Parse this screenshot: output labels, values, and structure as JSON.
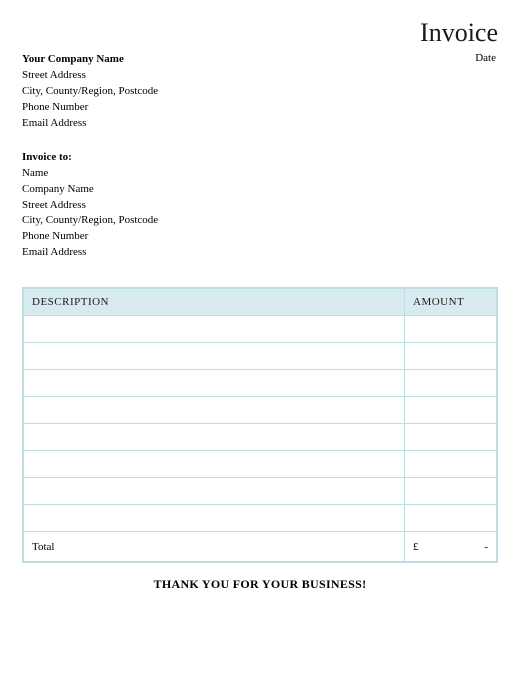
{
  "header": {
    "title": "Invoice",
    "date_label": "Date"
  },
  "from": {
    "company": "Your Company Name",
    "street": "Street Address",
    "city": "City, County/Region, Postcode",
    "phone": "Phone Number",
    "email": "Email Address"
  },
  "to": {
    "heading": "Invoice to:",
    "name": "Name",
    "company": "Company Name",
    "street": "Street Address",
    "city": "City, County/Region, Postcode",
    "phone": "Phone Number",
    "email": "Email Address"
  },
  "table": {
    "col_description": "DESCRIPTION",
    "col_amount": "AMOUNT",
    "rows": [
      {
        "description": "",
        "amount": ""
      },
      {
        "description": "",
        "amount": ""
      },
      {
        "description": "",
        "amount": ""
      },
      {
        "description": "",
        "amount": ""
      },
      {
        "description": "",
        "amount": ""
      },
      {
        "description": "",
        "amount": ""
      },
      {
        "description": "",
        "amount": ""
      },
      {
        "description": "",
        "amount": ""
      }
    ],
    "total_label": "Total",
    "currency_symbol": "£",
    "total_value": "-"
  },
  "footer": {
    "thanks": "THANK YOU FOR YOUR BUSINESS!"
  }
}
